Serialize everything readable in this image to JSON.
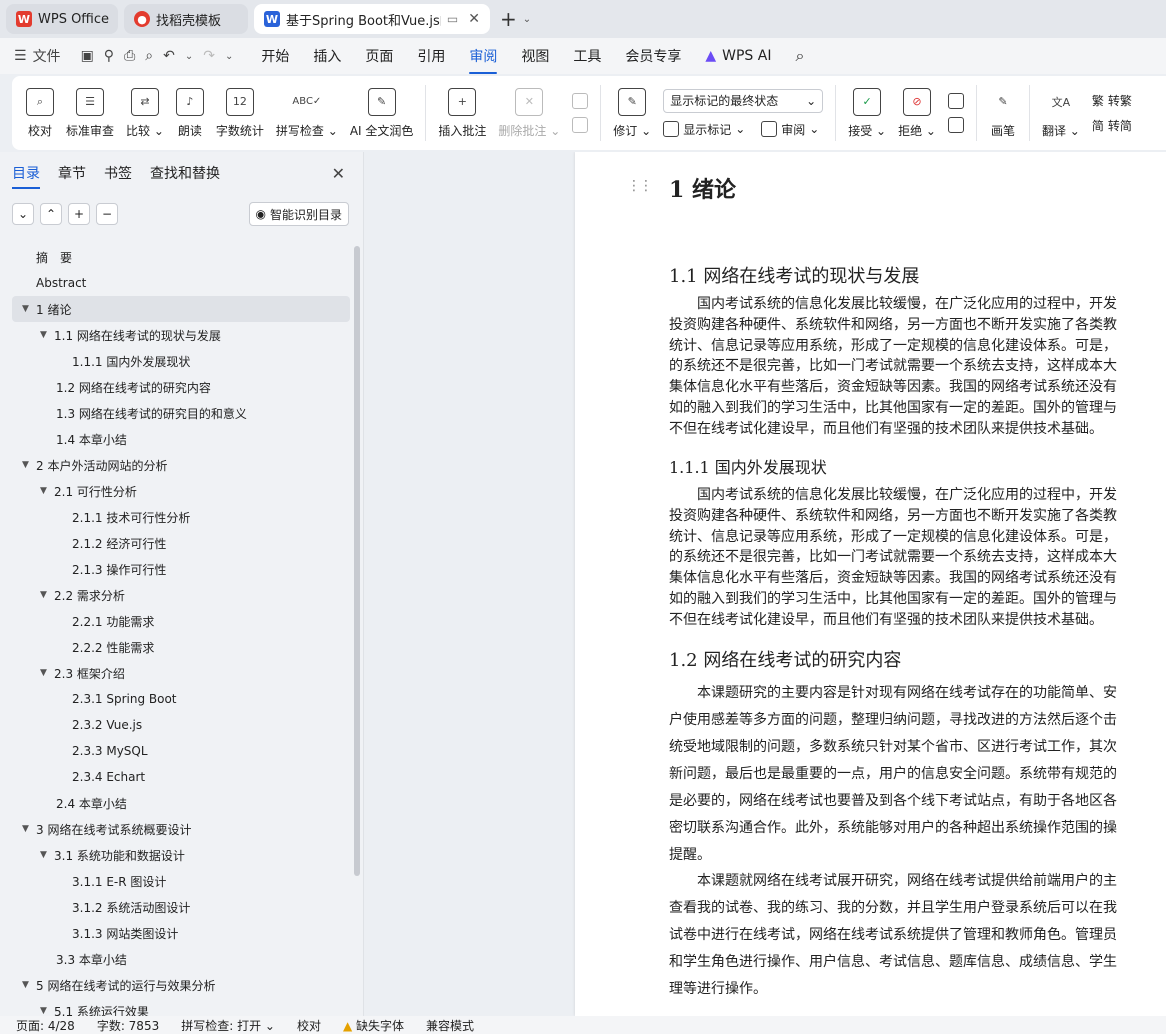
{
  "tabs": [
    {
      "label": "WPS Office",
      "icon": "wps-logo-icon",
      "color": "#e33b2e"
    },
    {
      "label": "找稻壳模板",
      "icon": "docer-icon",
      "color": "#e33b2e"
    },
    {
      "label": "基于Spring Boot和Vue.js的网",
      "icon": "word-doc-icon",
      "color": "#2b63d9"
    }
  ],
  "menubar": {
    "file": "文件",
    "items": [
      "开始",
      "插入",
      "页面",
      "引用",
      "审阅",
      "视图",
      "工具",
      "会员专享",
      "WPS AI"
    ],
    "active": "审阅"
  },
  "ribbon": {
    "proofread": "校对",
    "standard_review": "标准审查",
    "compare": "比较",
    "read_aloud": "朗读",
    "word_count": "字数统计",
    "spell_check": "拼写检查",
    "ai_polish": "AI 全文润色",
    "insert_comment": "插入批注",
    "delete_comment": "删除批注",
    "markup_select": "显示标记的最终状态",
    "track_changes": "修订",
    "show_markup": "显示标记",
    "review": "审阅",
    "accept": "接受",
    "reject": "拒绝",
    "ink": "画笔",
    "translate": "翻译",
    "to_traditional": "转繁",
    "to_simplified": "转简"
  },
  "left_panel": {
    "tabs": [
      "目录",
      "章节",
      "书签",
      "查找和替换"
    ],
    "active_tab": "目录",
    "smart_toc": "智能识别目录",
    "toc": [
      {
        "label": "摘　要",
        "level": 0,
        "caret": false
      },
      {
        "label": "Abstract",
        "level": 0,
        "caret": false
      },
      {
        "label": "1  绪论",
        "level": 0,
        "caret": true,
        "selected": true
      },
      {
        "label": "1.1  网络在线考试的现状与发展",
        "level": 1,
        "caret": true
      },
      {
        "label": "1.1.1  国内外发展现状",
        "level": 2,
        "caret": false
      },
      {
        "label": "1.2 网络在线考试的研究内容",
        "level": 1,
        "caret": false
      },
      {
        "label": "1.3  网络在线考试的研究目的和意义",
        "level": 1,
        "caret": false
      },
      {
        "label": "1.4  本章小结",
        "level": 1,
        "caret": false
      },
      {
        "label": "2  本户外活动网站的分析",
        "level": 0,
        "caret": true
      },
      {
        "label": "2.1  可行性分析",
        "level": 1,
        "caret": true
      },
      {
        "label": "2.1.1  技术可行性分析",
        "level": 2,
        "caret": false
      },
      {
        "label": "2.1.2  经济可行性",
        "level": 2,
        "caret": false
      },
      {
        "label": "2.1.3  操作可行性",
        "level": 2,
        "caret": false
      },
      {
        "label": "2.2  需求分析",
        "level": 1,
        "caret": true
      },
      {
        "label": "2.2.1  功能需求",
        "level": 2,
        "caret": false
      },
      {
        "label": "2.2.2  性能需求",
        "level": 2,
        "caret": false
      },
      {
        "label": "2.3  框架介绍",
        "level": 1,
        "caret": true
      },
      {
        "label": "2.3.1 Spring Boot",
        "level": 2,
        "caret": false
      },
      {
        "label": "2.3.2 Vue.js",
        "level": 2,
        "caret": false
      },
      {
        "label": "2.3.3 MySQL",
        "level": 2,
        "caret": false
      },
      {
        "label": "2.3.4 Echart",
        "level": 2,
        "caret": false
      },
      {
        "label": "2.4  本章小结",
        "level": 1,
        "caret": false
      },
      {
        "label": "3  网络在线考试系统概要设计",
        "level": 0,
        "caret": true
      },
      {
        "label": "3.1  系统功能和数据设计",
        "level": 1,
        "caret": true
      },
      {
        "label": "3.1.1 E-R 图设计",
        "level": 2,
        "caret": false
      },
      {
        "label": "3.1.2  系统活动图设计",
        "level": 2,
        "caret": false
      },
      {
        "label": "3.1.3  网站类图设计",
        "level": 2,
        "caret": false
      },
      {
        "label": "3.3  本章小结",
        "level": 1,
        "caret": false
      },
      {
        "label": "5  网络在线考试的运行与效果分析",
        "level": 0,
        "caret": true
      },
      {
        "label": "5.1  系统运行效果",
        "level": 1,
        "caret": true
      }
    ]
  },
  "document": {
    "h1": "1  绪论",
    "h2_1": "1.1  网络在线考试的现状与发展",
    "p1": [
      "　　国内考试系统的信息化发展比较缓慢，在广泛化应用的过程中，开发",
      "投资购建各种硬件、系统软件和网络，另一方面也不断开发实施了各类教",
      "统计、信息记录等应用系统，形成了一定规模的信息化建设体系。可是，",
      "的系统还不是很完善，比如一门考试就需要一个系统去支持，这样成本大",
      "集体信息化水平有些落后，资金短缺等因素。我国的网络考试系统还没有",
      "如的融入到我们的学习生活中，比其他国家有一定的差距。国外的管理与",
      "不但在线考试化建设早，而且他们有坚强的技术团队来提供技术基础。"
    ],
    "h3_1": "1.1.1  国内外发展现状",
    "p2": [
      "　　国内考试系统的信息化发展比较缓慢，在广泛化应用的过程中，开发",
      "投资购建各种硬件、系统软件和网络，另一方面也不断开发实施了各类教",
      "统计、信息记录等应用系统，形成了一定规模的信息化建设体系。可是，",
      "的系统还不是很完善，比如一门考试就需要一个系统去支持，这样成本大",
      "集体信息化水平有些落后，资金短缺等因素。我国的网络考试系统还没有",
      "如的融入到我们的学习生活中，比其他国家有一定的差距。国外的管理与",
      "不但在线考试化建设早，而且他们有坚强的技术团队来提供技术基础。"
    ],
    "h2_2": "1.2 网络在线考试的研究内容",
    "p3": [
      "　　本课题研究的主要内容是针对现有网络在线考试存在的功能简单、安",
      "户使用感差等多方面的问题，整理归纳问题，寻找改进的方法然后逐个击",
      "统受地域限制的问题，多数系统只针对某个省市、区进行考试工作，其次",
      "新问题，最后也是最重要的一点，用户的信息安全问题。系统带有规范的",
      "是必要的，网络在线考试也要普及到各个线下考试站点，有助于各地区各",
      "密切联系沟通合作。此外，系统能够对用户的各种超出系统操作范围的操",
      "提醒。"
    ],
    "p4": [
      "　　本课题就网络在线考试展开研究，网络在线考试提供给前端用户的主",
      "查看我的试卷、我的练习、我的分数，并且学生用户登录系统后可以在我",
      "试卷中进行在线考试，网络在线考试系统提供了管理和教师角色。管理员",
      "和学生角色进行操作、用户信息、考试信息、题库信息、成绩信息、学生",
      "理等进行操作。"
    ]
  },
  "status": {
    "page": "页面: 4/28",
    "words": "字数: 7853",
    "spell": "拼写检查: 打开",
    "proof": "校对",
    "missing_font": "缺失字体",
    "compat": "兼容模式"
  }
}
